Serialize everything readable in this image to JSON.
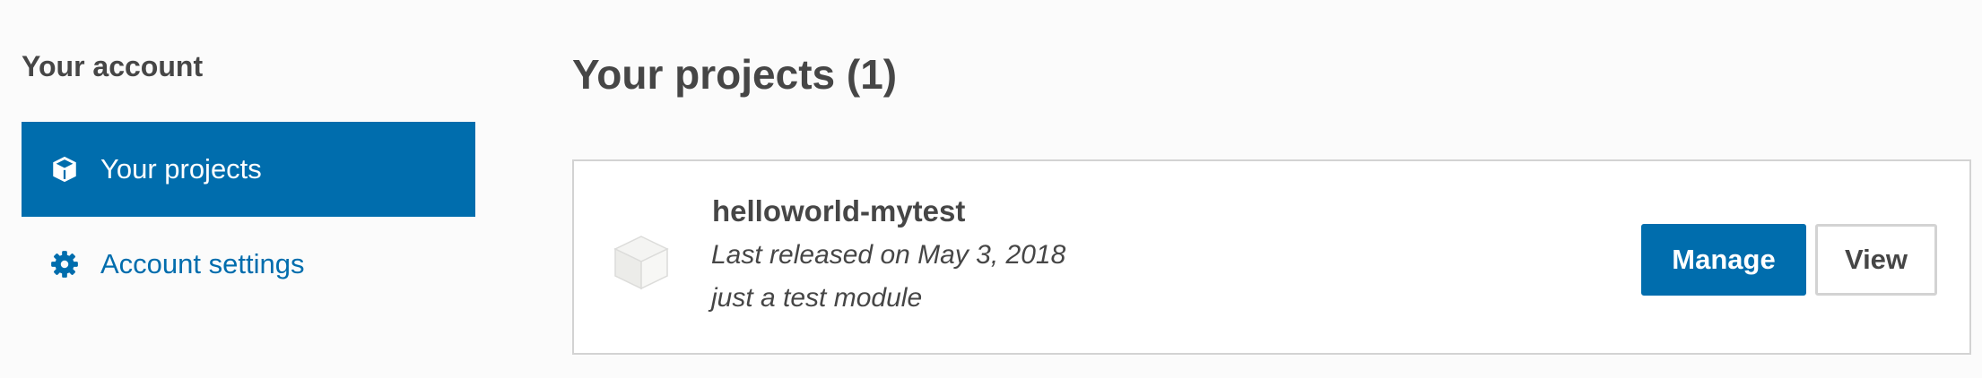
{
  "sidebar": {
    "heading": "Your account",
    "items": [
      {
        "label": "Your projects",
        "icon": "box-icon",
        "active": true
      },
      {
        "label": "Account settings",
        "icon": "gear-icon",
        "active": false
      }
    ]
  },
  "main": {
    "title": "Your projects (1)",
    "projects": [
      {
        "name": "helloworld-mytest",
        "released": "Last released on May 3, 2018",
        "description": "just a test module",
        "icon": "package-icon",
        "manage_label": "Manage",
        "view_label": "View"
      }
    ]
  },
  "colors": {
    "accent": "#006dad",
    "text": "#464646",
    "background": "#fbfbfb",
    "border": "#d3d3d3"
  }
}
